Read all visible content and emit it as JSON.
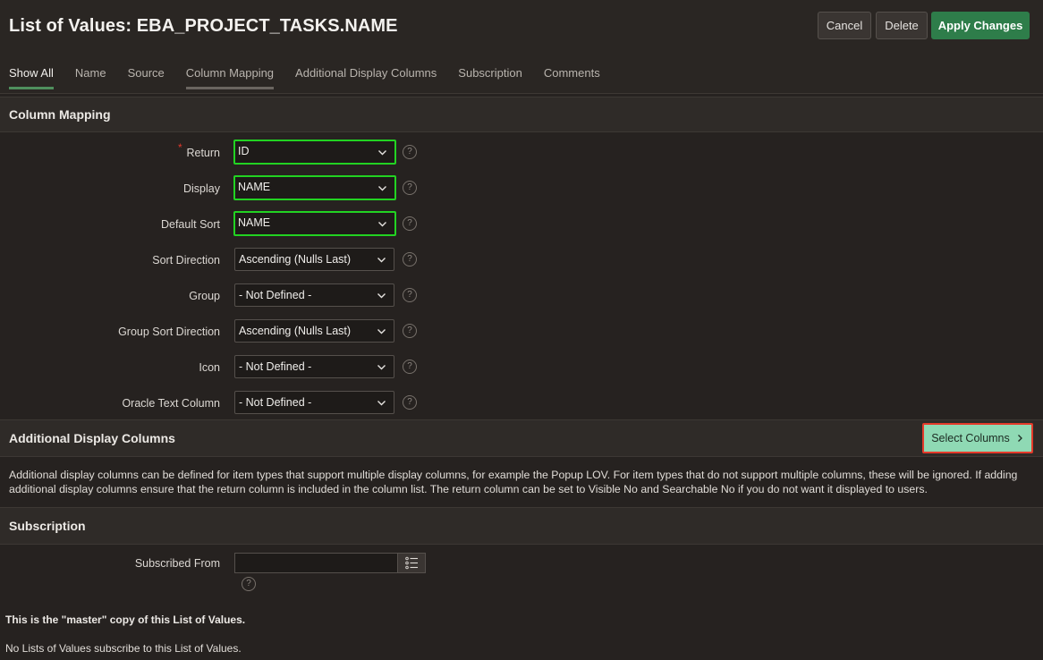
{
  "header": {
    "title": "List of Values: EBA_PROJECT_TASKS.NAME",
    "buttons": {
      "cancel": "Cancel",
      "delete": "Delete",
      "apply": "Apply Changes"
    }
  },
  "tabs": [
    {
      "label": "Show All",
      "state": "active"
    },
    {
      "label": "Name"
    },
    {
      "label": "Source"
    },
    {
      "label": "Column Mapping",
      "state": "current"
    },
    {
      "label": "Additional Display Columns"
    },
    {
      "label": "Subscription"
    },
    {
      "label": "Comments"
    }
  ],
  "column_mapping": {
    "title": "Column Mapping",
    "fields": [
      {
        "label": "Return",
        "value": "ID",
        "required": true,
        "highlighted": true
      },
      {
        "label": "Display",
        "value": "NAME",
        "highlighted": true
      },
      {
        "label": "Default Sort",
        "value": "NAME",
        "highlighted": true
      },
      {
        "label": "Sort Direction",
        "value": "Ascending (Nulls Last)"
      },
      {
        "label": "Group",
        "value": "- Not Defined -"
      },
      {
        "label": "Group Sort Direction",
        "value": "Ascending (Nulls Last)"
      },
      {
        "label": "Icon",
        "value": "- Not Defined -"
      },
      {
        "label": "Oracle Text Column",
        "value": "- Not Defined -"
      }
    ],
    "required_marker": "*",
    "help_glyph": "?"
  },
  "additional_display_columns": {
    "title": "Additional Display Columns",
    "button": "Select Columns",
    "description": "Additional display columns can be defined for item types that support multiple display columns, for example the Popup LOV. For item types that do not support multiple columns, these will be ignored. If adding additional display columns ensure that the return column is included in the column list. The return column can be set to Visible No and Searchable No if you do not want it displayed to users."
  },
  "subscription": {
    "title": "Subscription",
    "subscribed_from_label": "Subscribed From",
    "subscribed_from_value": "",
    "master_note": "This is the \"master\" copy of this List of Values.",
    "subscribers_note": "No Lists of Values subscribe to this List of Values."
  },
  "colors": {
    "background": "#262220",
    "apply_button": "#2e7d4a",
    "highlight_green": "#22d322",
    "highlight_red": "#e43a2a",
    "select_columns_button": "#8fd9b4"
  }
}
